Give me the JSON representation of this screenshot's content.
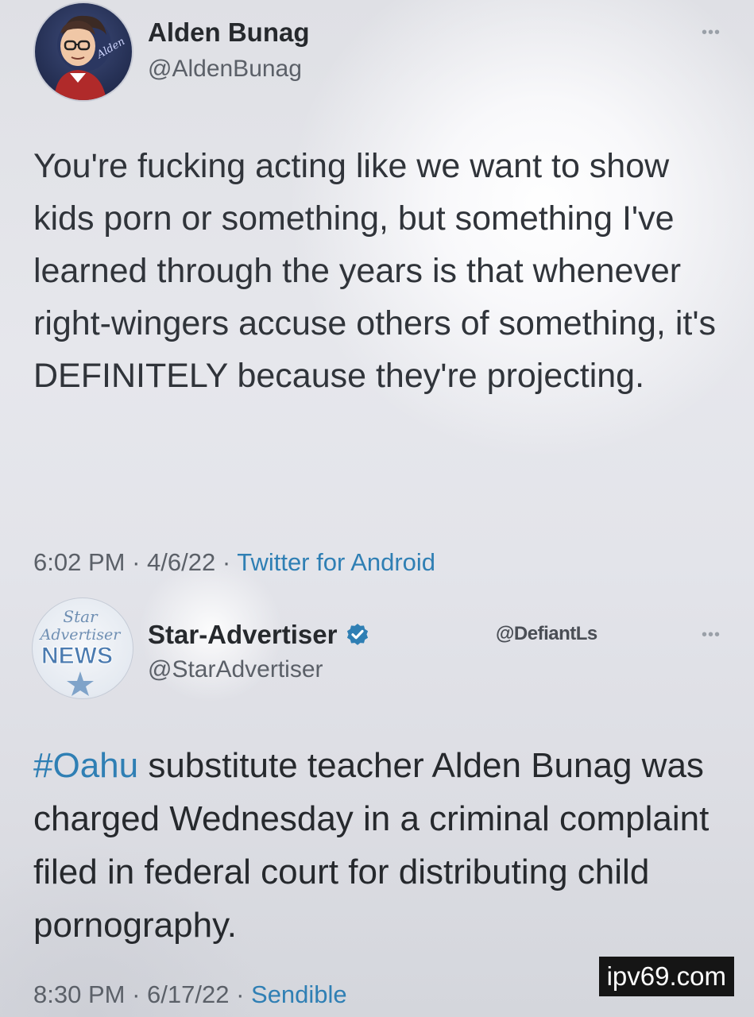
{
  "tweet1": {
    "display_name": "Alden Bunag",
    "handle": "@AldenBunag",
    "more_label": "•••",
    "text": "You're fucking acting like we want to show kids porn or something, but something I've learned through the years is that whenever right-wingers accuse others of something, it's DEFINITELY because they're projecting.",
    "time": "6:02 PM",
    "separator": " · ",
    "date": "4/6/22",
    "source": "Twitter for Android",
    "avatar_text": "Alden"
  },
  "tweet2": {
    "display_name": "Star-Advertiser",
    "handle": "@StarAdvertiser",
    "overlay_tag": "@DefiantLs",
    "more_label": "•••",
    "hashtag": "#Oahu",
    "text_rest": " substitute teacher Alden Bunag was charged Wednesday in a criminal complaint filed in federal court for distributing child pornography.",
    "time": "8:30 PM",
    "separator": " · ",
    "date": "6/17/22",
    "source": "Sendible",
    "avatar_logo": {
      "line1": "Star",
      "line2": "Advertiser",
      "line3": "NEWS"
    },
    "verified_color": "#2f7fb4"
  },
  "watermark": "ipv69.com",
  "colors": {
    "link": "#2f7fb4",
    "text": "#30343a",
    "muted": "#5b6068"
  }
}
